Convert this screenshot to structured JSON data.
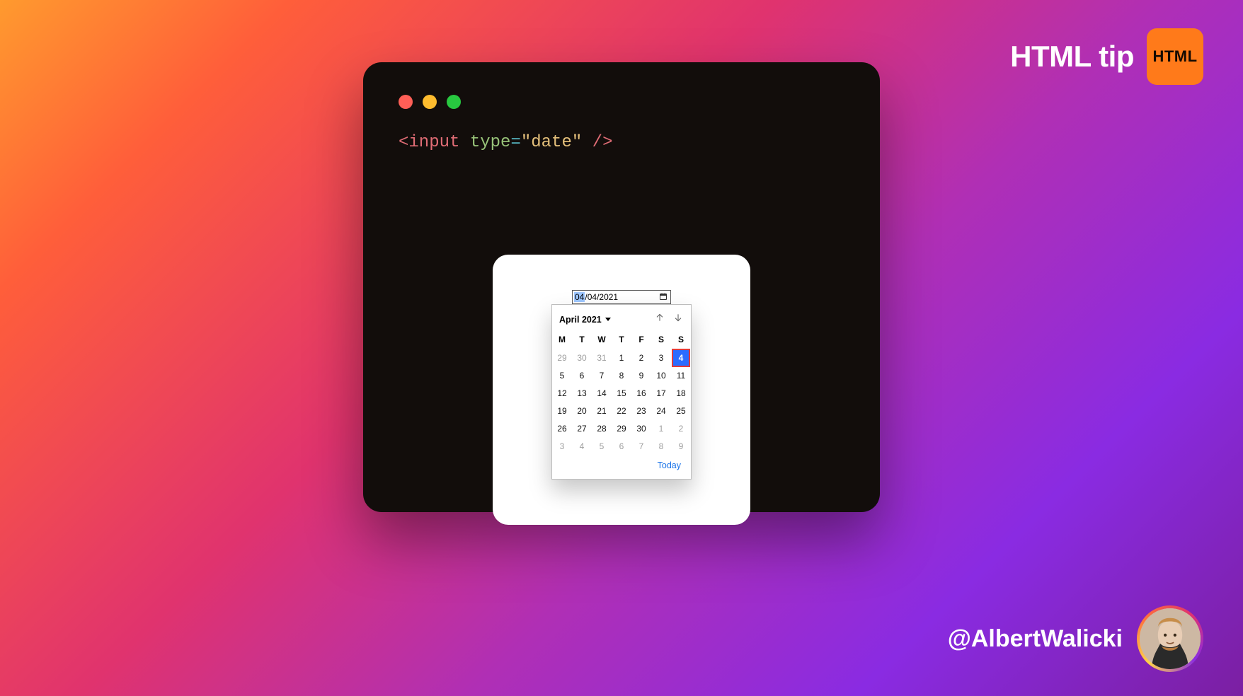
{
  "header": {
    "title": "HTML tip",
    "badge_label": "HTML"
  },
  "footer": {
    "handle": "@AlbertWalicki"
  },
  "code": {
    "open_bracket": "<",
    "tag": "input",
    "space1": " ",
    "attr": "type",
    "eq": "=",
    "quote_open": "\"",
    "value": "date",
    "quote_close": "\"",
    "space2": " ",
    "self_close": "/>"
  },
  "date_input": {
    "month": "04",
    "sep": "/",
    "day": "04",
    "year": "2021"
  },
  "calendar": {
    "month_label": "April 2021",
    "today_label": "Today",
    "weekdays": [
      "M",
      "T",
      "W",
      "T",
      "F",
      "S",
      "S"
    ],
    "rows": [
      [
        {
          "n": "29",
          "cls": "other"
        },
        {
          "n": "30",
          "cls": "other"
        },
        {
          "n": "31",
          "cls": "other"
        },
        {
          "n": "1",
          "cls": "cur"
        },
        {
          "n": "2",
          "cls": "cur"
        },
        {
          "n": "3",
          "cls": "cur"
        },
        {
          "n": "4",
          "cls": "sel"
        }
      ],
      [
        {
          "n": "5",
          "cls": "cur"
        },
        {
          "n": "6",
          "cls": "cur"
        },
        {
          "n": "7",
          "cls": "cur"
        },
        {
          "n": "8",
          "cls": "cur"
        },
        {
          "n": "9",
          "cls": "cur"
        },
        {
          "n": "10",
          "cls": "cur"
        },
        {
          "n": "11",
          "cls": "cur"
        }
      ],
      [
        {
          "n": "12",
          "cls": "cur"
        },
        {
          "n": "13",
          "cls": "cur"
        },
        {
          "n": "14",
          "cls": "cur"
        },
        {
          "n": "15",
          "cls": "cur"
        },
        {
          "n": "16",
          "cls": "cur"
        },
        {
          "n": "17",
          "cls": "cur"
        },
        {
          "n": "18",
          "cls": "cur"
        }
      ],
      [
        {
          "n": "19",
          "cls": "cur"
        },
        {
          "n": "20",
          "cls": "cur"
        },
        {
          "n": "21",
          "cls": "cur"
        },
        {
          "n": "22",
          "cls": "cur"
        },
        {
          "n": "23",
          "cls": "cur"
        },
        {
          "n": "24",
          "cls": "cur"
        },
        {
          "n": "25",
          "cls": "cur"
        }
      ],
      [
        {
          "n": "26",
          "cls": "cur"
        },
        {
          "n": "27",
          "cls": "cur"
        },
        {
          "n": "28",
          "cls": "cur"
        },
        {
          "n": "29",
          "cls": "cur"
        },
        {
          "n": "30",
          "cls": "cur"
        },
        {
          "n": "1",
          "cls": "other"
        },
        {
          "n": "2",
          "cls": "other"
        }
      ],
      [
        {
          "n": "3",
          "cls": "other"
        },
        {
          "n": "4",
          "cls": "other"
        },
        {
          "n": "5",
          "cls": "other"
        },
        {
          "n": "6",
          "cls": "other"
        },
        {
          "n": "7",
          "cls": "other"
        },
        {
          "n": "8",
          "cls": "other"
        },
        {
          "n": "9",
          "cls": "other"
        }
      ]
    ]
  }
}
